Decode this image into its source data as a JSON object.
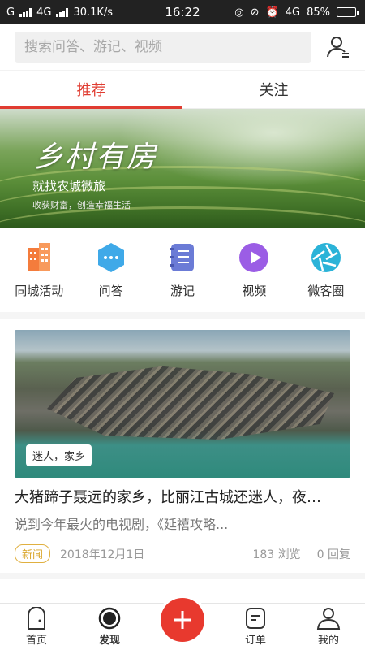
{
  "status": {
    "carrier1": "G",
    "carrier2": "4G",
    "speed": "30.1K/s",
    "time": "16:22",
    "network": "4G",
    "battery": "85%",
    "battery_level": 0.85
  },
  "search": {
    "placeholder": "搜索问答、游记、视频"
  },
  "tabs": [
    {
      "label": "推荐",
      "active": true
    },
    {
      "label": "关注",
      "active": false
    }
  ],
  "banner": {
    "title": "乡村有房",
    "subtitle": "就找农城微旅",
    "tagline": "收获财富，创造幸福生活"
  },
  "categories": [
    {
      "label": "同城活动",
      "icon": "building-icon",
      "color": "#f47c3c"
    },
    {
      "label": "问答",
      "icon": "chat-bubble-icon",
      "color": "#3fa9e8"
    },
    {
      "label": "游记",
      "icon": "notebook-icon",
      "color": "#6b7bd6"
    },
    {
      "label": "视频",
      "icon": "play-icon",
      "color": "#9b5de5"
    },
    {
      "label": "微客圈",
      "icon": "aperture-icon",
      "color": "#2bb3d8"
    }
  ],
  "article": {
    "tag": "迷人，家乡",
    "headline": "大猪蹄子聂远的家乡，比丽江古城还迷人，夜…",
    "summary": "说到今年最火的电视剧，《延禧攻略...",
    "badge": "新闻",
    "date": "2018年12月1日",
    "views": "183 浏览",
    "replies": "0 回复"
  },
  "bottom_nav": [
    {
      "label": "首页",
      "icon": "home-icon"
    },
    {
      "label": "发现",
      "icon": "discover-icon",
      "active": true
    },
    {
      "label": "订单",
      "icon": "order-icon"
    },
    {
      "label": "我的",
      "icon": "profile-icon"
    }
  ],
  "colors": {
    "accent": "#e03c31",
    "fab": "#e8392e"
  }
}
